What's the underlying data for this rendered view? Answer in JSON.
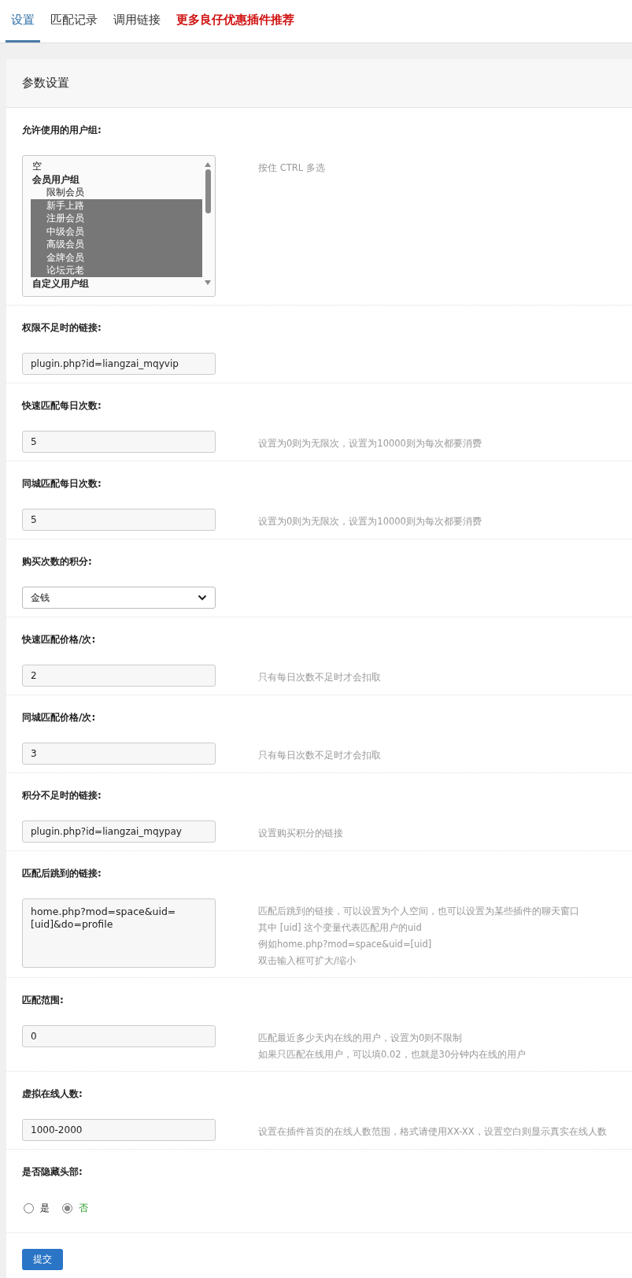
{
  "tabs": [
    {
      "label": "设置",
      "selected": true,
      "kind": "normal"
    },
    {
      "label": "匹配记录",
      "selected": false,
      "kind": "normal"
    },
    {
      "label": "调用链接",
      "selected": false,
      "kind": "normal"
    },
    {
      "label": "更多良仔优惠插件推荐",
      "selected": false,
      "kind": "promo"
    }
  ],
  "panel": {
    "title": "参数设置"
  },
  "settings": [
    {
      "kind": "listbox",
      "label": "允许使用的用户组:",
      "hints": [
        "按住 CTRL 多选"
      ],
      "options": [
        {
          "label": "空",
          "kind": "top",
          "selected": false
        },
        {
          "label": "会员用户组",
          "kind": "group",
          "selected": false
        },
        {
          "label": "限制会员",
          "kind": "option",
          "selected": false
        },
        {
          "label": "新手上路",
          "kind": "option",
          "selected": true
        },
        {
          "label": "注册会员",
          "kind": "option",
          "selected": true
        },
        {
          "label": "中级会员",
          "kind": "option",
          "selected": true
        },
        {
          "label": "高级会员",
          "kind": "option",
          "selected": true
        },
        {
          "label": "金牌会员",
          "kind": "option",
          "selected": true
        },
        {
          "label": "论坛元老",
          "kind": "option",
          "selected": true
        },
        {
          "label": "自定义用户组",
          "kind": "group",
          "selected": false
        }
      ]
    },
    {
      "kind": "text",
      "label": "权限不足时的链接:",
      "value": "plugin.php?id=liangzai_mqyvip"
    },
    {
      "kind": "text",
      "label": "快速匹配每日次数:",
      "value": "5",
      "hints": [
        "设置为0则为无限次，设置为10000则为每次都要消费"
      ]
    },
    {
      "kind": "text",
      "label": "同城匹配每日次数:",
      "value": "5",
      "hints": [
        "设置为0则为无限次，设置为10000则为每次都要消费"
      ]
    },
    {
      "kind": "select",
      "label": "购买次数的积分:",
      "value": "金钱"
    },
    {
      "kind": "text",
      "label": "快速匹配价格/次:",
      "value": "2",
      "hints": [
        "只有每日次数不足时才会扣取"
      ]
    },
    {
      "kind": "text",
      "label": "同城匹配价格/次:",
      "value": "3",
      "hints": [
        "只有每日次数不足时才会扣取"
      ]
    },
    {
      "kind": "text",
      "label": "积分不足时的链接:",
      "value": "plugin.php?id=liangzai_mqypay",
      "hints": [
        "设置购买积分的链接"
      ]
    },
    {
      "kind": "textarea",
      "label": "匹配后跳到的链接:",
      "value": "home.php?mod=space&uid=[uid]&do=profile",
      "hints": [
        "匹配后跳到的链接，可以设置为个人空间，也可以设置为某些插件的聊天窗口",
        "其中 [uid] 这个变量代表匹配用户的uid",
        "例如home.php?mod=space&uid=[uid]",
        "双击输入框可扩大/缩小"
      ]
    },
    {
      "kind": "text",
      "label": "匹配范围:",
      "value": "0",
      "hints": [
        "匹配最近多少天内在线的用户，设置为0则不限制",
        "如果只匹配在线用户，可以填0.02，也就是30分钟内在线的用户"
      ]
    },
    {
      "kind": "text",
      "label": "虚拟在线人数:",
      "value": "1000-2000",
      "hints": [
        "设置在插件首页的在线人数范围，格式请使用XX-XX，设置空白则显示真实在线人数"
      ]
    },
    {
      "kind": "radio",
      "label": "是否隐藏头部:",
      "options": [
        {
          "label": "是",
          "selected": false
        },
        {
          "label": "否",
          "selected": true
        }
      ]
    }
  ],
  "submit": "提交"
}
